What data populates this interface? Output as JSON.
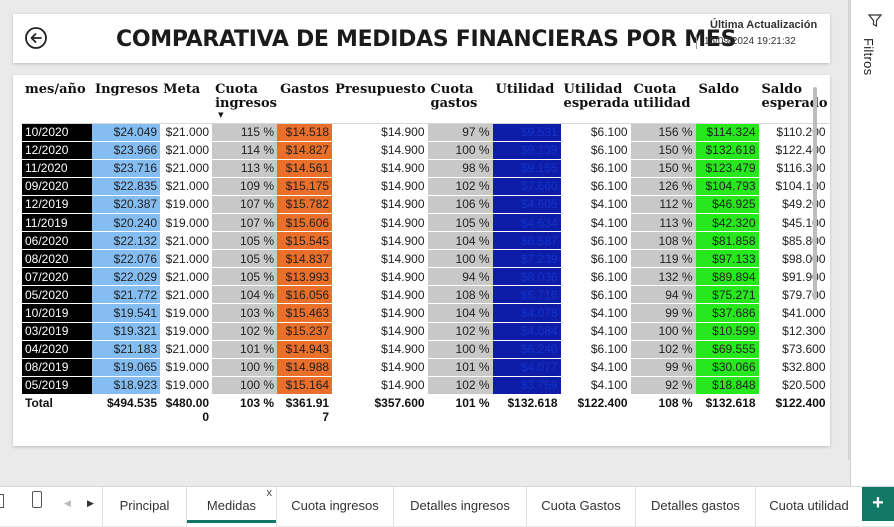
{
  "header": {
    "title": "COMPARATIVA DE MEDIDAS FINANCIERAS POR MES",
    "update_label": "Última Actualización",
    "update_value": "15/09/2024 19:21:32"
  },
  "filters_pane": {
    "label": "Filtros"
  },
  "table": {
    "columns": [
      "mes/año",
      "Ingresos",
      "Meta",
      "Cuota ingresos",
      "Gastos",
      "Presupuesto",
      "Cuota gastos",
      "Utilidad",
      "Utilidad esperada",
      "Cuota utilidad",
      "Saldo",
      "Saldo esperado"
    ],
    "rows": [
      [
        "10/2020",
        "$24.049",
        "$21.000",
        "115 %",
        "$14.518",
        "$14.900",
        "97 %",
        "$9.531",
        "$6.100",
        "156 %",
        "$114.324",
        "$110.200"
      ],
      [
        "12/2020",
        "$23.966",
        "$21.000",
        "114 %",
        "$14.827",
        "$14.900",
        "100 %",
        "$9.139",
        "$6.100",
        "150 %",
        "$132.618",
        "$122.400"
      ],
      [
        "11/2020",
        "$23.716",
        "$21.000",
        "113 %",
        "$14.561",
        "$14.900",
        "98 %",
        "$9.155",
        "$6.100",
        "150 %",
        "$123.479",
        "$116.300"
      ],
      [
        "09/2020",
        "$22.835",
        "$21.000",
        "109 %",
        "$15.175",
        "$14.900",
        "102 %",
        "$7.660",
        "$6.100",
        "126 %",
        "$104.793",
        "$104.100"
      ],
      [
        "12/2019",
        "$20.387",
        "$19.000",
        "107 %",
        "$15.782",
        "$14.900",
        "106 %",
        "$4.605",
        "$4.100",
        "112 %",
        "$46.925",
        "$49.200"
      ],
      [
        "11/2019",
        "$20.240",
        "$19.000",
        "107 %",
        "$15.606",
        "$14.900",
        "105 %",
        "$4.634",
        "$4.100",
        "113 %",
        "$42.320",
        "$45.100"
      ],
      [
        "06/2020",
        "$22.132",
        "$21.000",
        "105 %",
        "$15.545",
        "$14.900",
        "104 %",
        "$6.587",
        "$6.100",
        "108 %",
        "$81.858",
        "$85.800"
      ],
      [
        "08/2020",
        "$22.076",
        "$21.000",
        "105 %",
        "$14.837",
        "$14.900",
        "100 %",
        "$7.239",
        "$6.100",
        "119 %",
        "$97.133",
        "$98.000"
      ],
      [
        "07/2020",
        "$22.029",
        "$21.000",
        "105 %",
        "$13.993",
        "$14.900",
        "94 %",
        "$8.036",
        "$6.100",
        "132 %",
        "$89.894",
        "$91.900"
      ],
      [
        "05/2020",
        "$21.772",
        "$21.000",
        "104 %",
        "$16.056",
        "$14.900",
        "108 %",
        "$5.716",
        "$6.100",
        "94 %",
        "$75.271",
        "$79.700"
      ],
      [
        "10/2019",
        "$19.541",
        "$19.000",
        "103 %",
        "$15.463",
        "$14.900",
        "104 %",
        "$4.078",
        "$4.100",
        "99 %",
        "$37.686",
        "$41.000"
      ],
      [
        "03/2019",
        "$19.321",
        "$19.000",
        "102 %",
        "$15.237",
        "$14.900",
        "102 %",
        "$4.084",
        "$4.100",
        "100 %",
        "$10.599",
        "$12.300"
      ],
      [
        "04/2020",
        "$21.183",
        "$21.000",
        "101 %",
        "$14.943",
        "$14.900",
        "100 %",
        "$6.240",
        "$6.100",
        "102 %",
        "$69.555",
        "$73.600"
      ],
      [
        "08/2019",
        "$19.065",
        "$19.000",
        "100 %",
        "$14.988",
        "$14.900",
        "101 %",
        "$4.077",
        "$4.100",
        "99 %",
        "$30.066",
        "$32.800"
      ],
      [
        "05/2019",
        "$18.923",
        "$19.000",
        "100 %",
        "$15.164",
        "$14.900",
        "102 %",
        "$3.759",
        "$4.100",
        "92 %",
        "$18.848",
        "$20.500"
      ]
    ],
    "total": [
      "Total",
      "$494.535",
      "$480.000",
      "103 %",
      "$361.917",
      "$357.600",
      "101 %",
      "$132.618",
      "$122.400",
      "108 %",
      "$132.618",
      "$122.400"
    ],
    "cell_colors": {
      "mes": "#000000",
      "ingresos": "#84bdf1",
      "cuota": "#c8c8c8",
      "gastos": "#e96f2a",
      "utilidad": "#0d1da8",
      "saldo": "#27e81d"
    }
  },
  "tabs": [
    {
      "label": "Principal"
    },
    {
      "label": "Medidas",
      "active": true
    },
    {
      "label": "Cuota ingresos"
    },
    {
      "label": "Detalles ingresos"
    },
    {
      "label": "Cuota Gastos"
    },
    {
      "label": "Detalles gastos"
    },
    {
      "label": "Cuota utilidad"
    }
  ],
  "tab_close": "x",
  "add_tab": "+",
  "accent": "#117865"
}
